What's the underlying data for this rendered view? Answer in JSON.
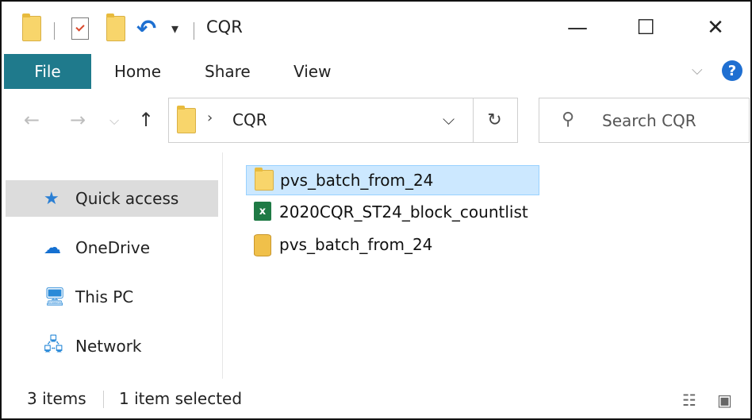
{
  "window": {
    "title": "CQR"
  },
  "titlebar": {
    "qa_caret": "▾",
    "minimize": "—",
    "maximize": "☐",
    "close": "✕"
  },
  "ribbon": {
    "tabs": [
      "File",
      "Home",
      "Share",
      "View"
    ],
    "collapse_chevron": "⌵",
    "help": "?"
  },
  "nav": {
    "back": "←",
    "forward": "→",
    "recent": "⌵",
    "up": "↑",
    "address_path": "CQR",
    "address_sep": "›",
    "dropdown": "⌵",
    "refresh": "↻"
  },
  "search": {
    "placeholder": "Search CQR",
    "icon": "⚲"
  },
  "sidebar": {
    "items": [
      {
        "label": "Quick access",
        "icon": "★",
        "icon_name": "quick-access-star-icon",
        "selected": true
      },
      {
        "label": "OneDrive",
        "icon": "☁",
        "icon_name": "onedrive-cloud-icon"
      },
      {
        "label": "This PC",
        "icon": "🖥",
        "icon_name": "this-pc-monitor-icon"
      },
      {
        "label": "Network",
        "icon": "🖧",
        "icon_name": "network-icon"
      }
    ]
  },
  "files": [
    {
      "name": "pvs_batch_from_24",
      "type": "folder",
      "selected": true
    },
    {
      "name": "2020CQR_ST24_block_countlist",
      "type": "excel",
      "icon_text": "x"
    },
    {
      "name": "pvs_batch_from_24",
      "type": "database"
    }
  ],
  "status": {
    "item_count": "3 items",
    "selection": "1 item selected",
    "details_view_icon": "☷",
    "large_icons_view_icon": "▣"
  },
  "colors": {
    "file_tab": "#1f7a8c",
    "selection_bg": "#cce8ff",
    "selection_border": "#99d1ff",
    "sidebar_selected": "#dcdcdc",
    "help": "#1f6fd1"
  }
}
